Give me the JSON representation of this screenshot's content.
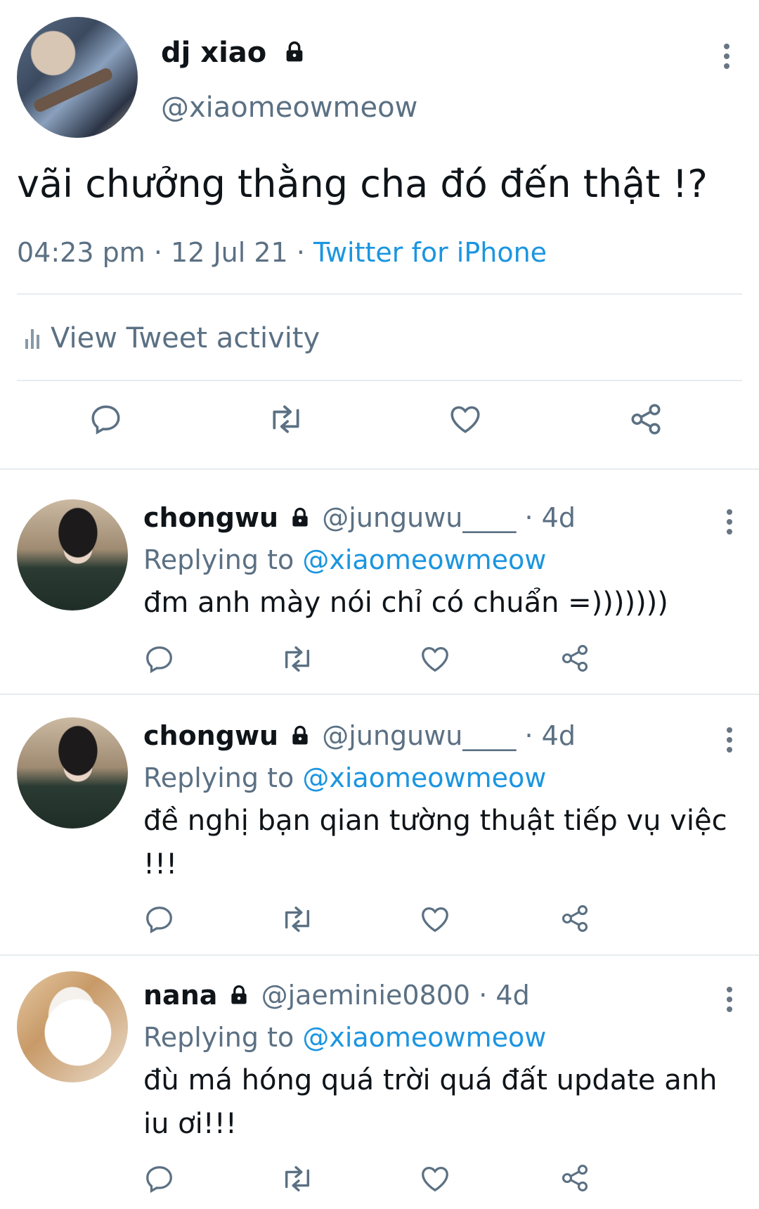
{
  "main_tweet": {
    "display_name": "dj xiao",
    "handle": "@xiaomeowmeow",
    "text": "vãi chưởng thằng cha đó đến thật !?",
    "time": "04:23 pm",
    "date": "12 Jul 21",
    "source": "Twitter for iPhone",
    "separator": "·",
    "activity_label": "View Tweet activity"
  },
  "replies": [
    {
      "display_name": "chongwu",
      "handle": "@junguwu____",
      "age": "4d",
      "replying_prefix": "Replying to",
      "replying_to": "@xiaomeowmeow",
      "text": "đm anh mày nói chỉ có chuẩn =)))))))"
    },
    {
      "display_name": "chongwu",
      "handle": "@junguwu____",
      "age": "4d",
      "replying_prefix": "Replying to",
      "replying_to": "@xiaomeowmeow",
      "text": "đề nghị bạn qian tường thuật tiếp vụ việc !!!"
    },
    {
      "display_name": "nana",
      "handle": "@jaeminie0800",
      "age": "4d",
      "replying_prefix": "Replying to",
      "replying_to": "@xiaomeowmeow",
      "text": "đù má hóng quá trời quá đất update anh iu ơi!!!"
    }
  ],
  "colors": {
    "link": "#1b95e0",
    "secondary_text": "#5b7083",
    "icon": "#5b7083",
    "divider": "#e6ecf0"
  },
  "icons": {
    "reply": "reply-icon",
    "retweet": "retweet-icon",
    "like": "heart-icon",
    "share": "share-icon",
    "more": "more-vertical-icon",
    "lock": "lock-icon",
    "activity": "bar-chart-icon"
  }
}
